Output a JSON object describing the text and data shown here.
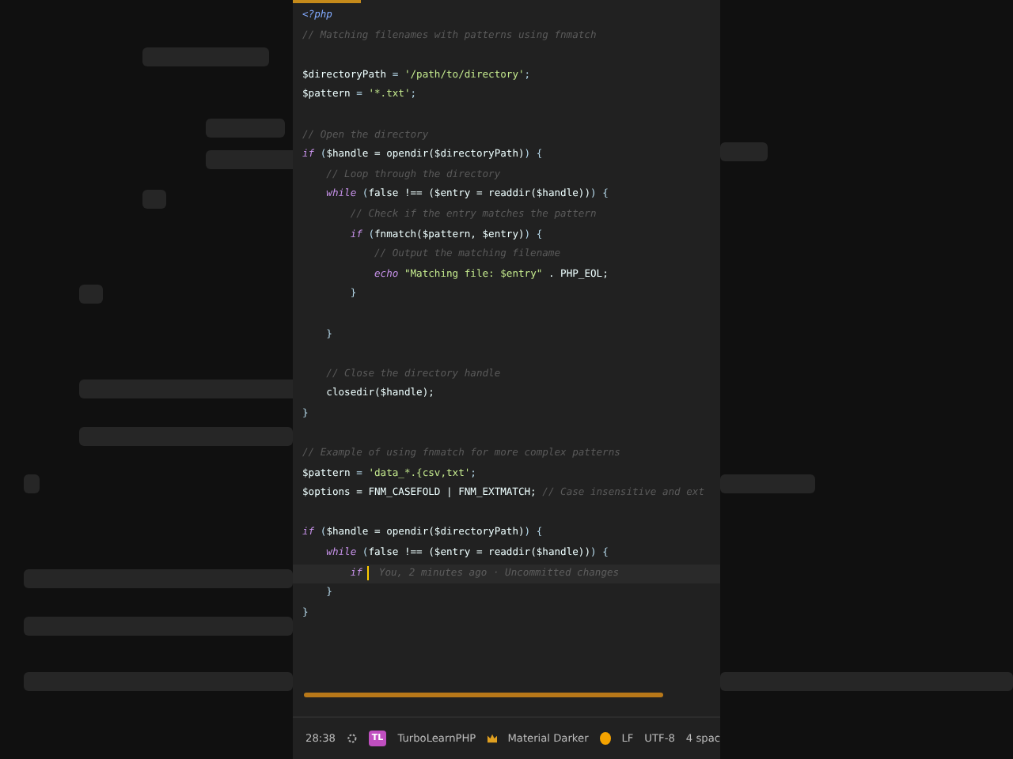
{
  "editor": {
    "lines": [
      {
        "kind": "code",
        "tokens": [
          {
            "kind": "tag",
            "text": "<?php"
          }
        ]
      },
      {
        "kind": "code",
        "tokens": [
          {
            "kind": "cm",
            "text": "// Matching filenames with patterns using fnmatch"
          }
        ]
      },
      {
        "kind": "blank"
      },
      {
        "kind": "code",
        "tokens": [
          {
            "kind": "var",
            "text": "$directoryPath"
          },
          {
            "kind": "op",
            "text": " = "
          },
          {
            "kind": "str",
            "text": "'/path/to/directory'"
          },
          {
            "kind": "op",
            "text": ";"
          }
        ]
      },
      {
        "kind": "code",
        "tokens": [
          {
            "kind": "var",
            "text": "$pattern"
          },
          {
            "kind": "op",
            "text": " = "
          },
          {
            "kind": "str",
            "text": "'*.txt'"
          },
          {
            "kind": "op",
            "text": ";"
          }
        ]
      },
      {
        "kind": "blank"
      },
      {
        "kind": "code",
        "tokens": [
          {
            "kind": "cm",
            "text": "// Open the directory"
          }
        ]
      },
      {
        "kind": "code",
        "tokens": [
          {
            "kind": "kw",
            "text": "if"
          },
          {
            "kind": "op",
            "text": " ("
          },
          {
            "kind": "var",
            "text": "$handle = opendir($directoryPath)"
          },
          {
            "kind": "op",
            "text": ") {"
          }
        ]
      },
      {
        "kind": "code",
        "tokens": [
          {
            "kind": "cm",
            "text": "    // Loop through the directory"
          }
        ]
      },
      {
        "kind": "code",
        "tokens": [
          {
            "kind": "kw",
            "text": "    while"
          },
          {
            "kind": "op",
            "text": " ("
          },
          {
            "kind": "var",
            "text": "false !== ($entry = readdir($handle))"
          },
          {
            "kind": "op",
            "text": ") {"
          }
        ]
      },
      {
        "kind": "code",
        "tokens": [
          {
            "kind": "cm",
            "text": "        // Check if the entry matches the pattern"
          }
        ]
      },
      {
        "kind": "code",
        "tokens": [
          {
            "kind": "kw",
            "text": "        if"
          },
          {
            "kind": "op",
            "text": " ("
          },
          {
            "kind": "var",
            "text": "fnmatch($pattern, $entry)"
          },
          {
            "kind": "op",
            "text": ") {"
          }
        ]
      },
      {
        "kind": "code",
        "tokens": [
          {
            "kind": "cm",
            "text": "            // Output the matching filename"
          }
        ]
      },
      {
        "kind": "code",
        "tokens": [
          {
            "kind": "kw",
            "text": "            echo"
          },
          {
            "kind": "str",
            "text": " \"Matching file: $entry\""
          },
          {
            "kind": "var",
            "text": " . PHP_EOL;"
          }
        ]
      },
      {
        "kind": "code",
        "tokens": [
          {
            "kind": "op",
            "text": "        }"
          }
        ]
      },
      {
        "kind": "blank"
      },
      {
        "kind": "code",
        "tokens": [
          {
            "kind": "op",
            "text": "    }"
          }
        ]
      },
      {
        "kind": "blank"
      },
      {
        "kind": "code",
        "tokens": [
          {
            "kind": "cm",
            "text": "    // Close the directory handle"
          }
        ]
      },
      {
        "kind": "code",
        "tokens": [
          {
            "kind": "var",
            "text": "    closedir($handle);"
          }
        ]
      },
      {
        "kind": "code",
        "tokens": [
          {
            "kind": "op",
            "text": "}"
          }
        ]
      },
      {
        "kind": "blank"
      },
      {
        "kind": "code",
        "tokens": [
          {
            "kind": "cm",
            "text": "// Example of using fnmatch for more complex patterns"
          }
        ]
      },
      {
        "kind": "code",
        "tokens": [
          {
            "kind": "var",
            "text": "$pattern"
          },
          {
            "kind": "op",
            "text": " = "
          },
          {
            "kind": "str",
            "text": "'data_*.{csv,txt'"
          },
          {
            "kind": "op",
            "text": ";"
          }
        ]
      },
      {
        "kind": "code",
        "tokens": [
          {
            "kind": "var",
            "text": "$options = FNM_CASEFOLD | FNM_EXTMATCH;"
          },
          {
            "kind": "cm",
            "text": " // Case insensitive and ext"
          }
        ]
      },
      {
        "kind": "blank"
      },
      {
        "kind": "code",
        "tokens": [
          {
            "kind": "kw",
            "text": "if"
          },
          {
            "kind": "op",
            "text": " ("
          },
          {
            "kind": "var",
            "text": "$handle = opendir($directoryPath)"
          },
          {
            "kind": "op",
            "text": ") {"
          }
        ]
      },
      {
        "kind": "code",
        "tokens": [
          {
            "kind": "kw",
            "text": "    while"
          },
          {
            "kind": "op",
            "text": " ("
          },
          {
            "kind": "var",
            "text": "false !== ($entry = readdir($handle))"
          },
          {
            "kind": "op",
            "text": ") {"
          }
        ]
      },
      {
        "kind": "code",
        "tokens": [
          {
            "kind": "kw",
            "text": "        if"
          }
        ],
        "blame": "You, 2 minutes ago · Uncommitted changes"
      },
      {
        "kind": "code",
        "tokens": [
          {
            "kind": "op",
            "text": "    }"
          }
        ]
      },
      {
        "kind": "code",
        "tokens": [
          {
            "kind": "op",
            "text": "}"
          }
        ]
      }
    ]
  },
  "status_bar": {
    "time": "28:38",
    "project_badge": "TL",
    "project": "TurboLearnPHP",
    "theme": "Material Darker",
    "line_ending": "LF",
    "encoding": "UTF-8",
    "indent": "4 spac"
  }
}
